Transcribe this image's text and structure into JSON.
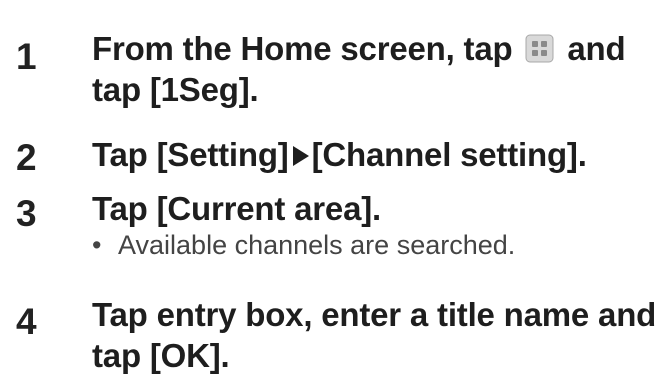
{
  "steps": [
    {
      "number": "1",
      "text_before_icon": "From the Home screen, tap",
      "icon": "app-launcher-icon",
      "text_after_icon": "and tap [1Seg]."
    },
    {
      "number": "2",
      "text_before_arrow": "Tap [Setting]",
      "arrow": "right-triangle-icon",
      "text_after_arrow": "[Channel setting]."
    },
    {
      "number": "3",
      "text": "Tap [Current area].",
      "note": "Available channels are searched."
    },
    {
      "number": "4",
      "text": "Tap entry box, enter a title name and tap [OK]."
    }
  ],
  "colors": {
    "text": "#1e1e1e",
    "note": "#444444",
    "icon_fill": "#d9d9d9",
    "icon_dots": "#8a8a8a"
  }
}
